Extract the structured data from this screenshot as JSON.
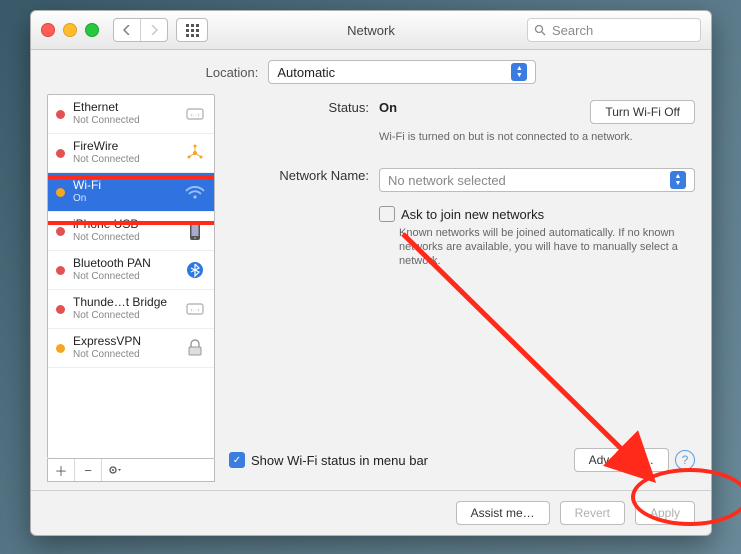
{
  "window": {
    "title": "Network"
  },
  "search": {
    "placeholder": "Search"
  },
  "location": {
    "label": "Location:",
    "value": "Automatic"
  },
  "sidebar": {
    "items": [
      {
        "name": "Ethernet",
        "status": "Not Connected",
        "dot": "red",
        "icon": "ethernet"
      },
      {
        "name": "FireWire",
        "status": "Not Connected",
        "dot": "red",
        "icon": "firewire"
      },
      {
        "name": "Wi-Fi",
        "status": "On",
        "dot": "amber",
        "icon": "wifi",
        "selected": true
      },
      {
        "name": "iPhone USB",
        "status": "Not Connected",
        "dot": "red",
        "icon": "iphone"
      },
      {
        "name": "Bluetooth PAN",
        "status": "Not Connected",
        "dot": "red",
        "icon": "bluetooth"
      },
      {
        "name": "Thunde…t Bridge",
        "status": "Not Connected",
        "dot": "red",
        "icon": "thunderbolt"
      },
      {
        "name": "ExpressVPN",
        "status": "Not Connected",
        "dot": "amber",
        "icon": "vpn"
      }
    ]
  },
  "detail": {
    "status_label": "Status:",
    "status_value": "On",
    "wifi_off_btn": "Turn Wi-Fi Off",
    "status_desc": "Wi-Fi is turned on but is not connected to a network.",
    "network_name_label": "Network Name:",
    "network_name_value": "No network selected",
    "ask_join": "Ask to join new networks",
    "ask_join_desc": "Known networks will be joined automatically. If no known networks are available, you will have to manually select a network.",
    "show_status": "Show Wi-Fi status in menu bar",
    "advanced_btn": "Advanced…"
  },
  "footer": {
    "assist": "Assist me…",
    "revert": "Revert",
    "apply": "Apply"
  },
  "annotation": {
    "highlight_item": "Wi-Fi",
    "highlight_button": "Advanced…",
    "arrow": true
  }
}
